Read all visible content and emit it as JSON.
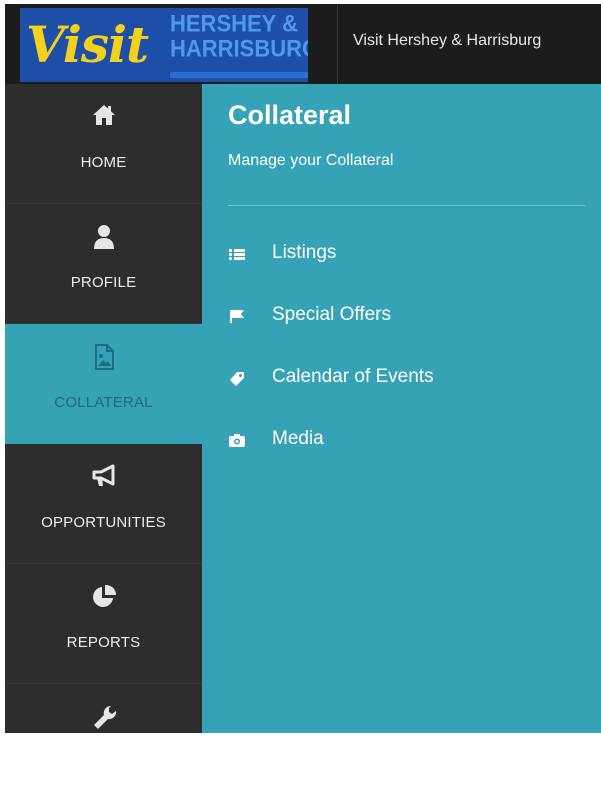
{
  "header": {
    "logo": {
      "visit": "Visit",
      "line1": "HERSHEY &",
      "line2": "HARRISBURG"
    },
    "title": "Visit Hershey & Harrisburg"
  },
  "sidebar": {
    "items": [
      {
        "label": "HOME",
        "icon": "home-icon"
      },
      {
        "label": "PROFILE",
        "icon": "user-icon"
      },
      {
        "label": "COLLATERAL",
        "icon": "image-file-icon",
        "active": true
      },
      {
        "label": "OPPORTUNITIES",
        "icon": "megaphone-icon"
      },
      {
        "label": "REPORTS",
        "icon": "pie-chart-icon"
      },
      {
        "label": "",
        "icon": "wrench-icon"
      }
    ]
  },
  "main": {
    "title": "Collateral",
    "subtitle": "Manage your Collateral",
    "menu": [
      {
        "label": "Listings",
        "icon": "list-icon"
      },
      {
        "label": "Special Offers",
        "icon": "flag-icon"
      },
      {
        "label": "Calendar of Events",
        "icon": "tag-icon"
      },
      {
        "label": "Media",
        "icon": "camera-icon"
      }
    ]
  },
  "colors": {
    "topbar": "#1c1c1c",
    "sidebar": "#2d2d2d",
    "accent": "#36a2b6",
    "logo_blue": "#1d4fa8",
    "logo_yellow": "#f3d11c"
  }
}
